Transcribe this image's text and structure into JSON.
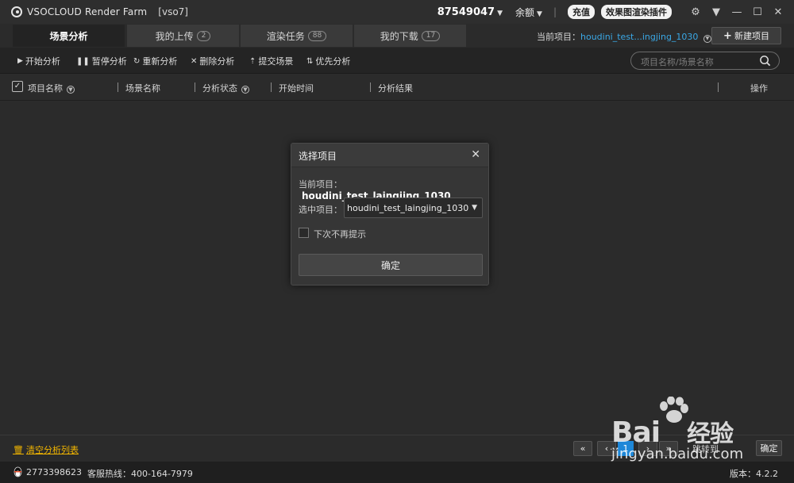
{
  "titlebar": {
    "app_name": "VSOCLOUD Render Farm",
    "user_tag": "[vso7]",
    "account_id": "87549047",
    "balance_label": "余额",
    "recharge": "充值",
    "plugin": "效果图渲染插件"
  },
  "tabs": [
    {
      "label": "场景分析",
      "badge": ""
    },
    {
      "label": "我的上传",
      "badge": "2"
    },
    {
      "label": "渲染任务",
      "badge": "88"
    },
    {
      "label": "我的下载",
      "badge": "17"
    }
  ],
  "current_project": {
    "label": "当前项目：",
    "value": "houdini_test...ingjing_1030"
  },
  "new_project": "新建项目",
  "toolbar": {
    "start": "开始分析",
    "pause": "暂停分析",
    "restart": "重新分析",
    "delete": "删除分析",
    "submit": "提交场景",
    "priority": "优先分析"
  },
  "search": {
    "placeholder": "项目名称/场景名称"
  },
  "columns": {
    "project": "项目名称",
    "scene": "场景名称",
    "status": "分析状态",
    "start_time": "开始时间",
    "result": "分析结果",
    "action": "操作"
  },
  "dialog": {
    "title": "选择项目",
    "current_label": "当前项目：",
    "current_value": "houdini_test_laingjing_1030",
    "selected_label": "选中项目：",
    "selected_value": "houdini_test_laingjing_1030",
    "dont_show": "下次不再提示",
    "ok": "确定"
  },
  "footer": {
    "clear_list": "清空分析列表",
    "page_current": "1",
    "page_ellipsis": "...",
    "jump_label": "跳转到",
    "ok": "确定",
    "qq": "2773398623",
    "hotline": "客服热线：400-164-7979",
    "version": "版本：4.2.2"
  },
  "watermark": {
    "brand": "Bai",
    "brand_cn": "经验",
    "url": "jingyan.baidu.com"
  },
  "colors": {
    "accent_blue": "#3aa8e6",
    "page_blue": "#1e87d8",
    "clear_yellow": "#f0b400"
  }
}
